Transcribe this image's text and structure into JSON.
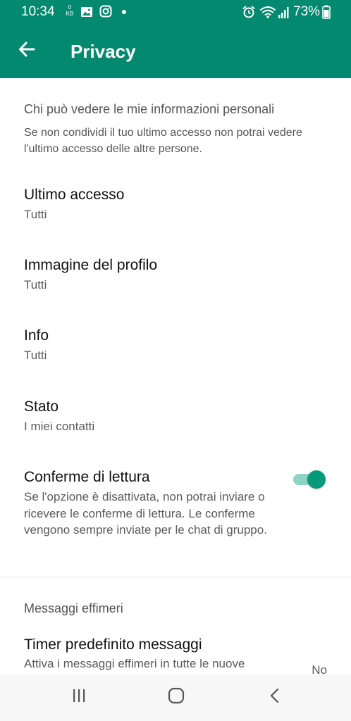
{
  "status_bar": {
    "time": "10:34",
    "network_speed_value": "0",
    "network_speed_unit": "KB",
    "battery": "73%",
    "icons": [
      "image-icon",
      "instagram-icon",
      "dot-icon",
      "alarm-icon",
      "wifi-icon",
      "signal-icon",
      "battery-icon"
    ]
  },
  "app_bar": {
    "title": "Privacy",
    "back_icon": "arrow-left-icon"
  },
  "privacy": {
    "section_header": "Chi può vedere le mie informazioni personali",
    "section_description": "Se non condividi il tuo ultimo accesso non potrai vedere l'ultimo accesso delle altre persone.",
    "items": [
      {
        "title": "Ultimo accesso",
        "value": "Tutti"
      },
      {
        "title": "Immagine del profilo",
        "value": "Tutti"
      },
      {
        "title": "Info",
        "value": "Tutti"
      },
      {
        "title": "Stato",
        "value": "I miei contatti"
      }
    ],
    "read_receipts": {
      "title": "Conferme di lettura",
      "description": "Se l'opzione è disattivata, non potrai inviare o ricevere le conferme di lettura. Le conferme vengono sempre inviate per le chat di gruppo.",
      "enabled": true
    }
  },
  "disappearing": {
    "section_header": "Messaggi effimeri",
    "timer": {
      "title": "Timer predefinito messaggi",
      "description": "Attiva i messaggi effimeri in tutte le nuove",
      "value": "No"
    }
  },
  "colors": {
    "primary": "#03896f",
    "accent": "#08997c",
    "track": "#8dd4c4"
  },
  "nav_bar": {
    "icons": [
      "recent-apps-icon",
      "home-icon",
      "back-chevron-icon"
    ]
  }
}
